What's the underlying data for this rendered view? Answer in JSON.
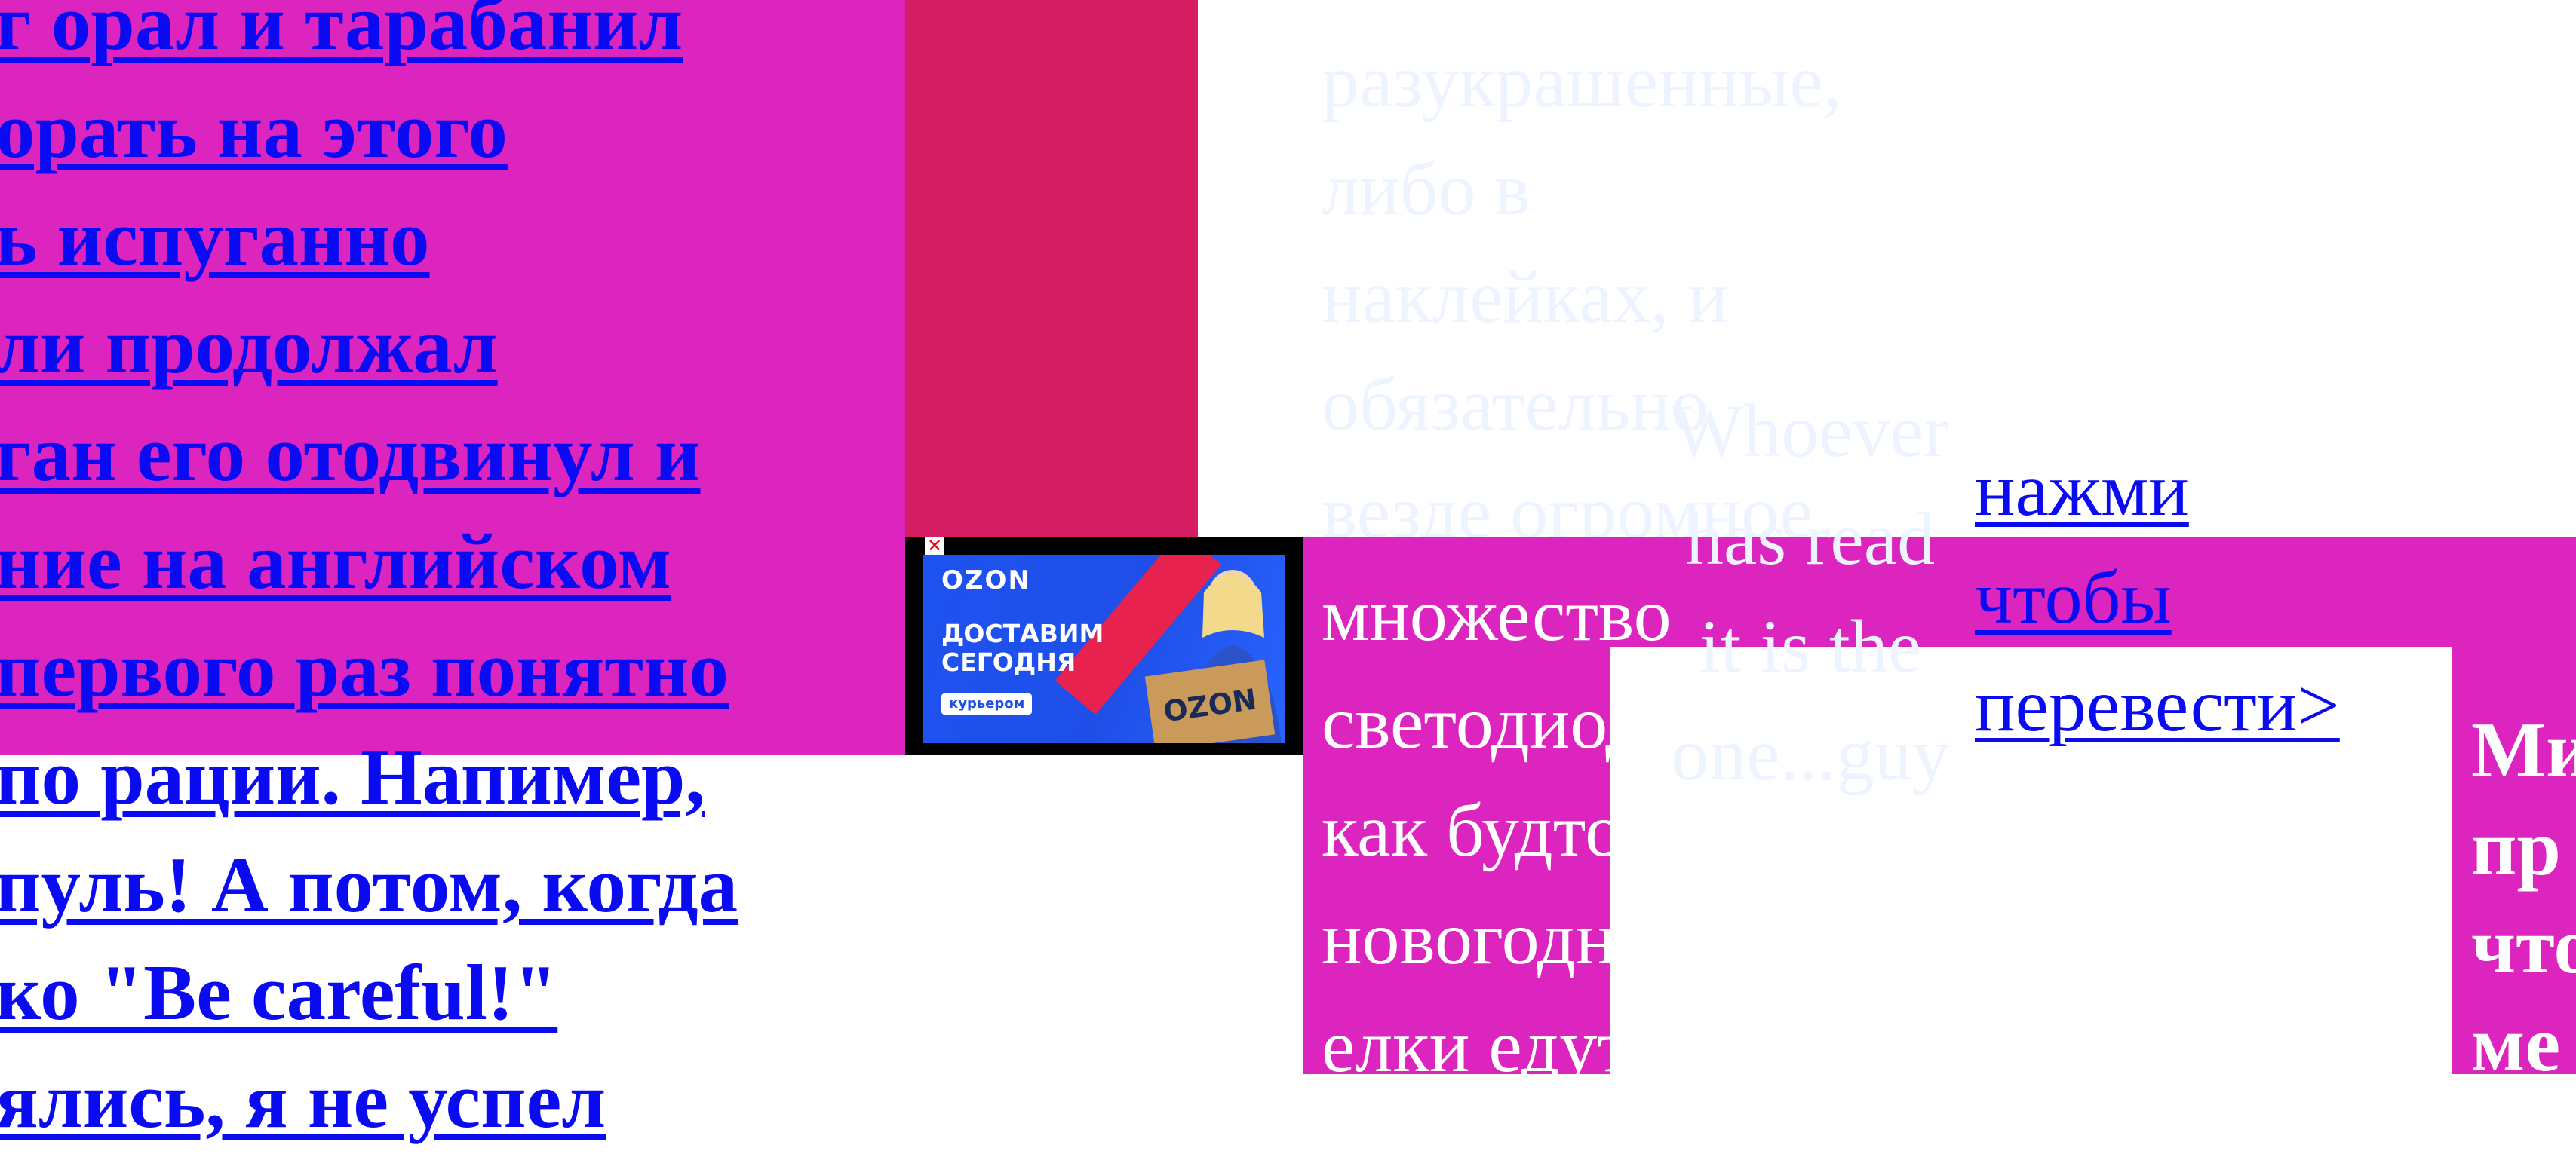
{
  "left_article": {
    "lines": [
      "г орал и тарабанил",
      "орать на этого",
      "ь испуганно",
      "ли продолжал",
      "ган его отодвинул и",
      "ние на английском",
      "первого раз понятно",
      "по рации. Напимер,",
      "пуль! А потом, когда",
      "ко \"Be careful!\"",
      "ялись, я не успел"
    ]
  },
  "ad": {
    "close_glyph": "✕",
    "logo": "OZON",
    "headline": "ДОСТАВИМ СЕГОДНЯ",
    "chip": "курьером",
    "box_logo": "OZON"
  },
  "faded_text": {
    "lines": [
      "разукрашенные,",
      "либо в",
      "наклейках, и",
      "обязательно",
      "везде огромное"
    ]
  },
  "middle_text": {
    "lines": [
      "множество",
      "светодиодов,",
      "как будто",
      "новогодние",
      "елки едут и"
    ]
  },
  "who_text": {
    "lines": [
      "Whoever",
      "has read",
      "it is the",
      "one...guy"
    ]
  },
  "translate_link": {
    "lines": [
      "нажми",
      "чтобы",
      "перевести>"
    ]
  },
  "right_text": {
    "lines": [
      "Ми",
      "пр",
      "что",
      "ме"
    ]
  },
  "colors": {
    "magenta": "#db25be",
    "crimson": "#d61f63",
    "link_blue": "#0b0bf2",
    "ad_blue": "#1f4fe8"
  }
}
